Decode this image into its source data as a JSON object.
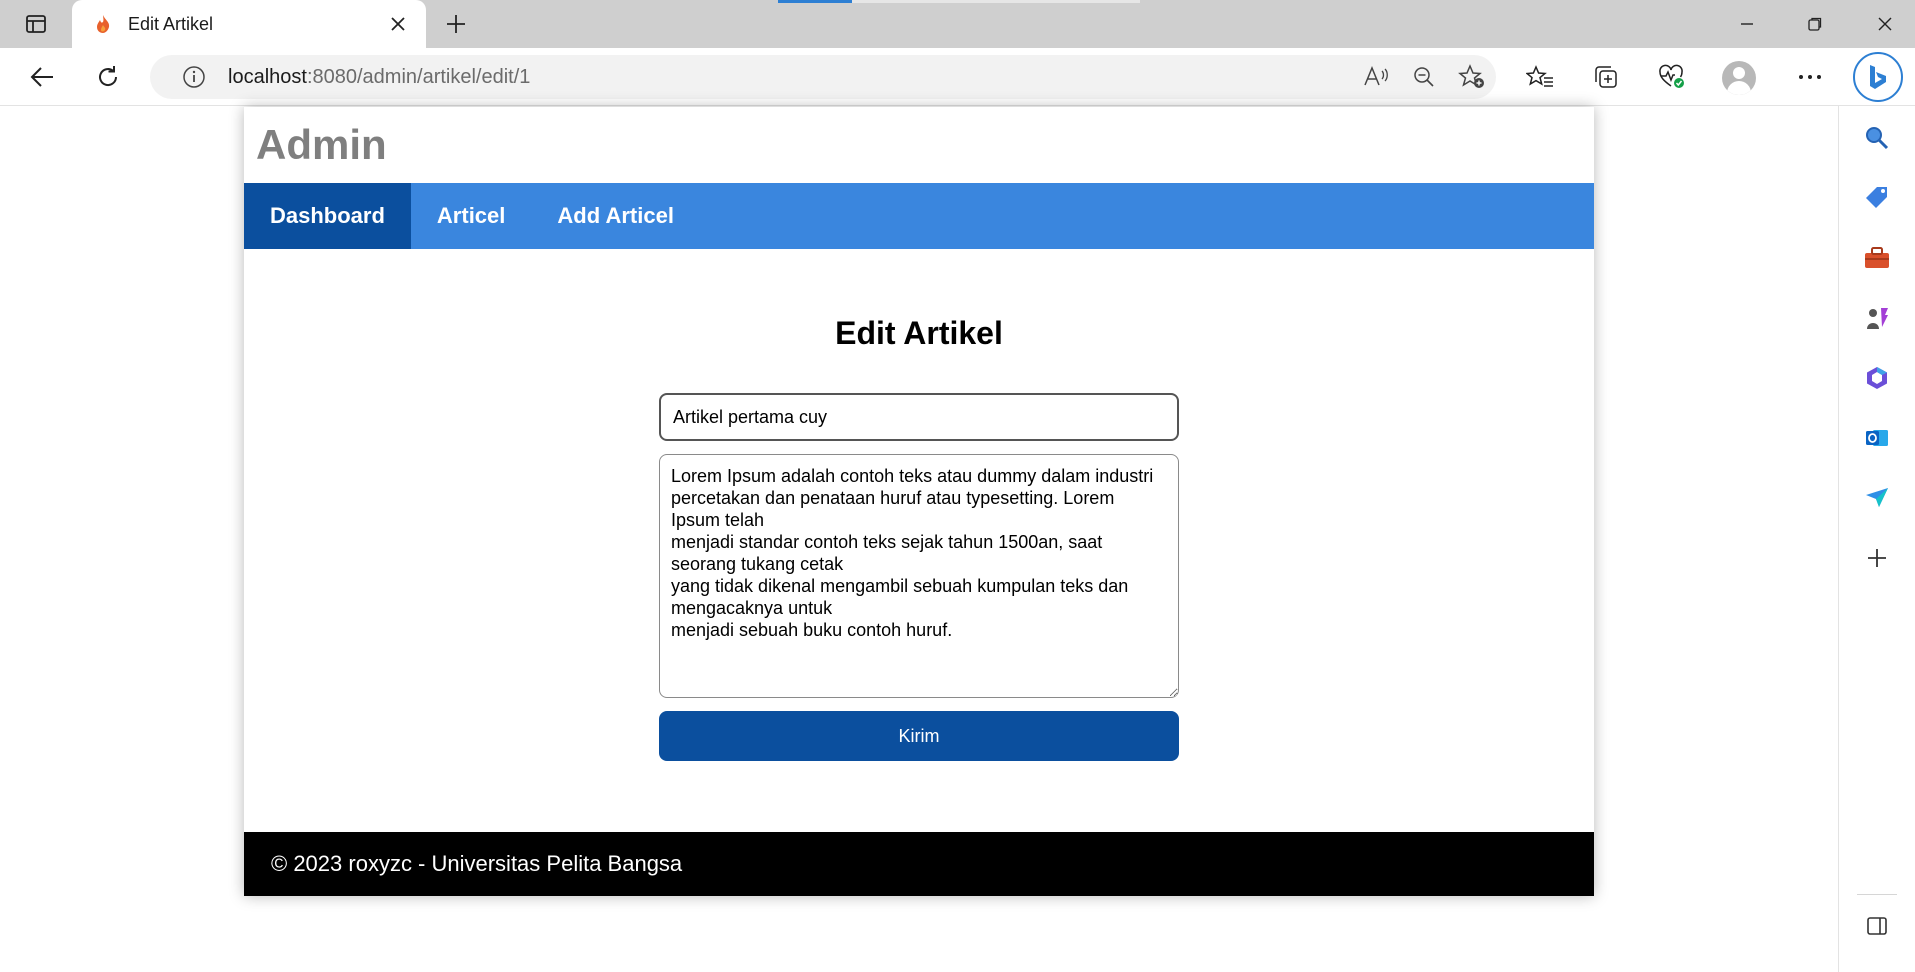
{
  "browser": {
    "tab": {
      "title": "Edit Artikel"
    },
    "address": {
      "host": "localhost",
      "path": ":8080/admin/artikel/edit/1"
    }
  },
  "page": {
    "site_title": "Admin",
    "nav": [
      {
        "label": "Dashboard",
        "active": true
      },
      {
        "label": "Articel",
        "active": false
      },
      {
        "label": "Add Articel",
        "active": false
      }
    ],
    "heading": "Edit Artikel",
    "form": {
      "title_value": "Artikel pertama cuy",
      "content_value": "Lorem Ipsum adalah contoh teks atau dummy dalam industri percetakan dan penataan huruf atau typesetting. Lorem Ipsum telah\nmenjadi standar contoh teks sejak tahun 1500an, saat seorang tukang cetak\nyang tidak dikenal mengambil sebuah kumpulan teks dan mengacaknya untuk\nmenjadi sebuah buku contoh huruf.",
      "submit_label": "Kirim"
    },
    "footer": "© 2023 roxyzc - Universitas Pelita Bangsa"
  },
  "colors": {
    "nav_bg": "#3a86de",
    "nav_active": "#0b4f9e",
    "button": "#0b4f9e",
    "footer_bg": "#000000",
    "site_title": "#7f7f7f"
  },
  "icons": {
    "sidebar": [
      "search-icon",
      "shopping-tag-icon",
      "toolbox-icon",
      "games-icon",
      "office-icon",
      "outlook-icon",
      "drop-icon",
      "add-icon",
      "sidebar-toggle-icon"
    ]
  }
}
